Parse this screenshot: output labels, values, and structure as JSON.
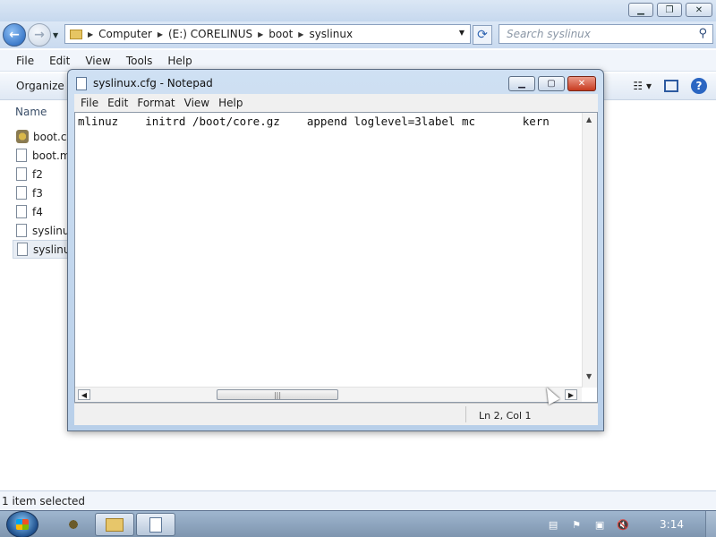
{
  "explorer": {
    "address": [
      "Computer",
      "(E:) CORELINUS",
      "boot",
      "syslinux"
    ],
    "search_placeholder": "Search syslinux",
    "menu": [
      "File",
      "Edit",
      "View",
      "Tools",
      "Help"
    ],
    "organize_label": "Organize",
    "column_header": "Name",
    "files": [
      "boot.ca",
      "boot.m",
      "f2",
      "f3",
      "f4",
      "syslinu",
      "syslinu"
    ],
    "status": "1 item selected"
  },
  "notepad": {
    "title": "syslinux.cfg - Notepad",
    "menu": [
      "File",
      "Edit",
      "Format",
      "View",
      "Help"
    ],
    "content": "mlinuz    initrd /boot/core.gz    append loglevel=3label mc       kern",
    "position": "Ln 2, Col 1"
  },
  "taskbar": {
    "clock": "3:14"
  },
  "icons": {
    "back": "back-arrow-icon",
    "forward": "forward-arrow-icon",
    "refresh": "refresh-icon",
    "search": "search-icon",
    "help": "help-icon"
  }
}
